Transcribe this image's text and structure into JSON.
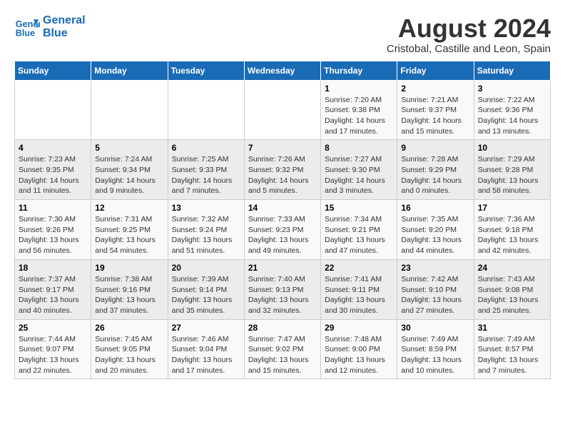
{
  "header": {
    "logo_line1": "General",
    "logo_line2": "Blue",
    "month_year": "August 2024",
    "location": "Cristobal, Castille and Leon, Spain"
  },
  "weekdays": [
    "Sunday",
    "Monday",
    "Tuesday",
    "Wednesday",
    "Thursday",
    "Friday",
    "Saturday"
  ],
  "weeks": [
    [
      {
        "day": "",
        "info": ""
      },
      {
        "day": "",
        "info": ""
      },
      {
        "day": "",
        "info": ""
      },
      {
        "day": "",
        "info": ""
      },
      {
        "day": "1",
        "info": "Sunrise: 7:20 AM\nSunset: 9:38 PM\nDaylight: 14 hours\nand 17 minutes."
      },
      {
        "day": "2",
        "info": "Sunrise: 7:21 AM\nSunset: 9:37 PM\nDaylight: 14 hours\nand 15 minutes."
      },
      {
        "day": "3",
        "info": "Sunrise: 7:22 AM\nSunset: 9:36 PM\nDaylight: 14 hours\nand 13 minutes."
      }
    ],
    [
      {
        "day": "4",
        "info": "Sunrise: 7:23 AM\nSunset: 9:35 PM\nDaylight: 14 hours\nand 11 minutes."
      },
      {
        "day": "5",
        "info": "Sunrise: 7:24 AM\nSunset: 9:34 PM\nDaylight: 14 hours\nand 9 minutes."
      },
      {
        "day": "6",
        "info": "Sunrise: 7:25 AM\nSunset: 9:33 PM\nDaylight: 14 hours\nand 7 minutes."
      },
      {
        "day": "7",
        "info": "Sunrise: 7:26 AM\nSunset: 9:32 PM\nDaylight: 14 hours\nand 5 minutes."
      },
      {
        "day": "8",
        "info": "Sunrise: 7:27 AM\nSunset: 9:30 PM\nDaylight: 14 hours\nand 3 minutes."
      },
      {
        "day": "9",
        "info": "Sunrise: 7:28 AM\nSunset: 9:29 PM\nDaylight: 14 hours\nand 0 minutes."
      },
      {
        "day": "10",
        "info": "Sunrise: 7:29 AM\nSunset: 9:28 PM\nDaylight: 13 hours\nand 58 minutes."
      }
    ],
    [
      {
        "day": "11",
        "info": "Sunrise: 7:30 AM\nSunset: 9:26 PM\nDaylight: 13 hours\nand 56 minutes."
      },
      {
        "day": "12",
        "info": "Sunrise: 7:31 AM\nSunset: 9:25 PM\nDaylight: 13 hours\nand 54 minutes."
      },
      {
        "day": "13",
        "info": "Sunrise: 7:32 AM\nSunset: 9:24 PM\nDaylight: 13 hours\nand 51 minutes."
      },
      {
        "day": "14",
        "info": "Sunrise: 7:33 AM\nSunset: 9:23 PM\nDaylight: 13 hours\nand 49 minutes."
      },
      {
        "day": "15",
        "info": "Sunrise: 7:34 AM\nSunset: 9:21 PM\nDaylight: 13 hours\nand 47 minutes."
      },
      {
        "day": "16",
        "info": "Sunrise: 7:35 AM\nSunset: 9:20 PM\nDaylight: 13 hours\nand 44 minutes."
      },
      {
        "day": "17",
        "info": "Sunrise: 7:36 AM\nSunset: 9:18 PM\nDaylight: 13 hours\nand 42 minutes."
      }
    ],
    [
      {
        "day": "18",
        "info": "Sunrise: 7:37 AM\nSunset: 9:17 PM\nDaylight: 13 hours\nand 40 minutes."
      },
      {
        "day": "19",
        "info": "Sunrise: 7:38 AM\nSunset: 9:16 PM\nDaylight: 13 hours\nand 37 minutes."
      },
      {
        "day": "20",
        "info": "Sunrise: 7:39 AM\nSunset: 9:14 PM\nDaylight: 13 hours\nand 35 minutes."
      },
      {
        "day": "21",
        "info": "Sunrise: 7:40 AM\nSunset: 9:13 PM\nDaylight: 13 hours\nand 32 minutes."
      },
      {
        "day": "22",
        "info": "Sunrise: 7:41 AM\nSunset: 9:11 PM\nDaylight: 13 hours\nand 30 minutes."
      },
      {
        "day": "23",
        "info": "Sunrise: 7:42 AM\nSunset: 9:10 PM\nDaylight: 13 hours\nand 27 minutes."
      },
      {
        "day": "24",
        "info": "Sunrise: 7:43 AM\nSunset: 9:08 PM\nDaylight: 13 hours\nand 25 minutes."
      }
    ],
    [
      {
        "day": "25",
        "info": "Sunrise: 7:44 AM\nSunset: 9:07 PM\nDaylight: 13 hours\nand 22 minutes."
      },
      {
        "day": "26",
        "info": "Sunrise: 7:45 AM\nSunset: 9:05 PM\nDaylight: 13 hours\nand 20 minutes."
      },
      {
        "day": "27",
        "info": "Sunrise: 7:46 AM\nSunset: 9:04 PM\nDaylight: 13 hours\nand 17 minutes."
      },
      {
        "day": "28",
        "info": "Sunrise: 7:47 AM\nSunset: 9:02 PM\nDaylight: 13 hours\nand 15 minutes."
      },
      {
        "day": "29",
        "info": "Sunrise: 7:48 AM\nSunset: 9:00 PM\nDaylight: 13 hours\nand 12 minutes."
      },
      {
        "day": "30",
        "info": "Sunrise: 7:49 AM\nSunset: 8:59 PM\nDaylight: 13 hours\nand 10 minutes."
      },
      {
        "day": "31",
        "info": "Sunrise: 7:49 AM\nSunset: 8:57 PM\nDaylight: 13 hours\nand 7 minutes."
      }
    ]
  ]
}
